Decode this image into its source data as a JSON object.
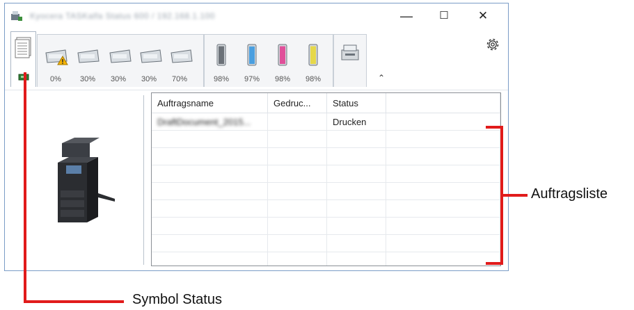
{
  "window": {
    "title": "Kyocera TASKalfa Status 600 / 192.168.1.100",
    "minimize_glyph": "—",
    "maximize_glyph": "☐",
    "close_glyph": "✕"
  },
  "toolbar": {
    "paper_levels": [
      "0%",
      "30%",
      "30%",
      "30%",
      "70%"
    ],
    "toner_levels": [
      "98%",
      "97%",
      "98%",
      "98%"
    ],
    "toner_colors": [
      "#6b7178",
      "#4a9fe0",
      "#e0509a",
      "#e6d84a"
    ],
    "collapse_glyph": "⌃",
    "icons": [
      "status-tab-icon",
      "paper-tray-icon",
      "warning-icon",
      "toner-icon",
      "scanner-icon",
      "gear-icon"
    ]
  },
  "job_list": {
    "columns": [
      "Auftragsname",
      "Gedruc...",
      "Status"
    ],
    "rows": [
      {
        "name": "DraftDocument_2015...",
        "printed": "",
        "status": "Drucken"
      }
    ]
  },
  "annotations": {
    "job_list_label": "Auftragsliste",
    "status_icon_label": "Symbol Status",
    "callout_color": "#e11b1b"
  }
}
